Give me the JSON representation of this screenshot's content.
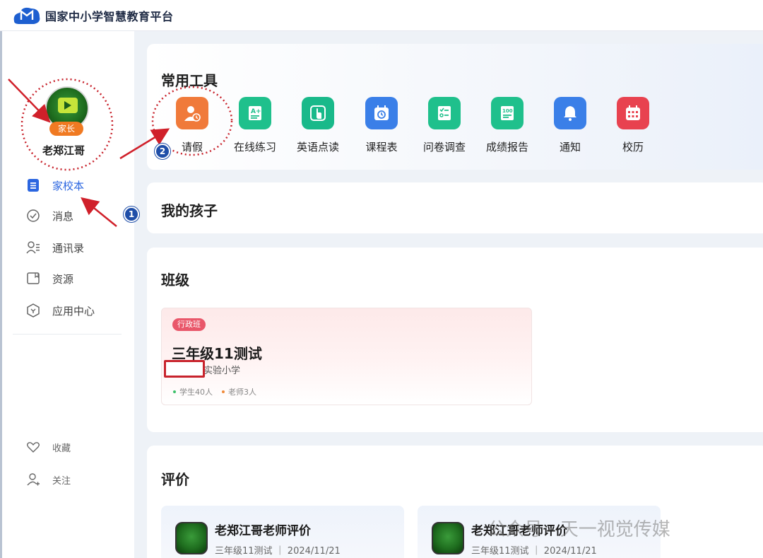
{
  "app": {
    "title": "国家中小学智慧教育平台"
  },
  "user": {
    "name": "老郑江哥",
    "role": "家长"
  },
  "sidebar": {
    "items": [
      {
        "label": "家校本",
        "icon": "list-icon",
        "active": true
      },
      {
        "label": "消息",
        "icon": "chat-check-icon"
      },
      {
        "label": "通讯录",
        "icon": "contacts-icon"
      },
      {
        "label": "资源",
        "icon": "folder-icon"
      },
      {
        "label": "应用中心",
        "icon": "app-center-icon"
      }
    ],
    "bottom": [
      {
        "label": "收藏",
        "icon": "heart-icon"
      },
      {
        "label": "关注",
        "icon": "person-follow-icon"
      }
    ]
  },
  "tools": {
    "title": "常用工具",
    "items": [
      {
        "label": "请假",
        "icon": "leave-request-icon",
        "color": "#f07a3a"
      },
      {
        "label": "在线练习",
        "icon": "practice-icon",
        "color": "#1fc08c"
      },
      {
        "label": "英语点读",
        "icon": "tap-read-icon",
        "color": "#19b98a"
      },
      {
        "label": "课程表",
        "icon": "timetable-icon",
        "color": "#3a7fe8"
      },
      {
        "label": "问卷调查",
        "icon": "survey-icon",
        "color": "#1fc08c"
      },
      {
        "label": "成绩报告",
        "icon": "score-report-icon",
        "color": "#1fc08c"
      },
      {
        "label": "通知",
        "icon": "bell-icon",
        "color": "#3a7fe8"
      },
      {
        "label": "校历",
        "icon": "calendar-icon",
        "color": "#e8424f"
      }
    ]
  },
  "children": {
    "title": "我的孩子"
  },
  "classes": {
    "title": "班级",
    "card": {
      "tag": "行政班",
      "name": "三年级11测试",
      "school": "实验小学",
      "students": "学生40人",
      "teachers": "老师3人"
    }
  },
  "evaluation": {
    "title": "评价",
    "items": [
      {
        "title": "老郑江哥老师评价",
        "meta": "三年级11测试 ｜ 2024/11/21"
      },
      {
        "title": "老郑江哥老师评价",
        "meta": "三年级11测试 ｜ 2024/11/21"
      }
    ]
  },
  "annotations": {
    "step1": "1",
    "step2": "2"
  },
  "watermark": "公众号 · 天一视觉传媒"
}
